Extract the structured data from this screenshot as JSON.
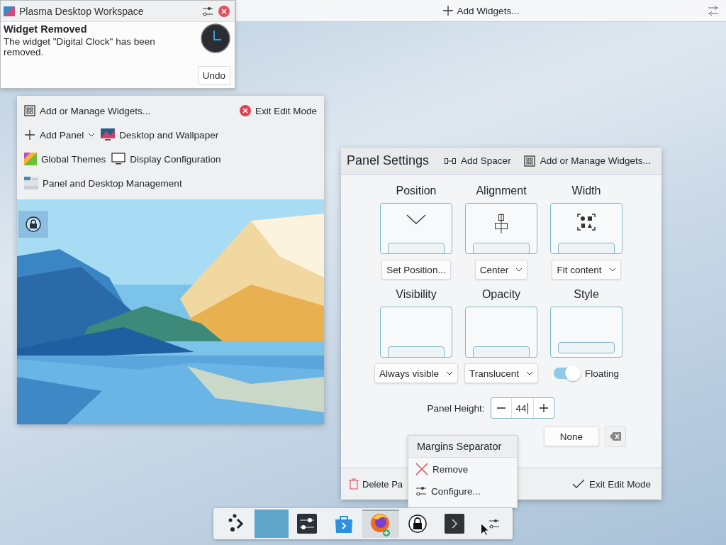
{
  "top_bar": {
    "add_widgets": "Add Widgets..."
  },
  "notification": {
    "app_name": "Plasma Desktop Workspace",
    "title": "Widget Removed",
    "body": "The widget \"Digital Clock\" has been removed.",
    "action": "Undo"
  },
  "edit_toolbar": {
    "rows": [
      [
        {
          "kind": "widgets",
          "label": "Add or Manage Widgets..."
        },
        {
          "kind": "exit",
          "label": "Exit Edit Mode"
        }
      ],
      [
        {
          "kind": "add-panel",
          "label": "Add Panel"
        },
        {
          "kind": "wallpaper",
          "label": "Desktop and Wallpaper"
        }
      ],
      [
        {
          "kind": "themes",
          "label": "Global Themes"
        },
        {
          "kind": "display",
          "label": "Display Configuration"
        }
      ],
      [
        {
          "kind": "management",
          "label": "Panel and Desktop Management"
        }
      ]
    ]
  },
  "panel_settings": {
    "title": "Panel Settings",
    "actions": [
      {
        "kind": "spacer",
        "label": "Add Spacer"
      },
      {
        "kind": "widgets",
        "label": "Add or Manage Widgets..."
      }
    ],
    "options": [
      {
        "kind": "position",
        "label": "Position",
        "control": {
          "kind": "button",
          "label": "Set Position..."
        }
      },
      {
        "kind": "alignment",
        "label": "Alignment",
        "control": {
          "kind": "dropdown",
          "label": "Center"
        }
      },
      {
        "kind": "width",
        "label": "Width",
        "control": {
          "kind": "dropdown",
          "label": "Fit content"
        }
      },
      {
        "kind": "visibility",
        "label": "Visibility",
        "control": {
          "kind": "dropdown",
          "label": "Always visible"
        }
      },
      {
        "kind": "opacity",
        "label": "Opacity",
        "control": {
          "kind": "dropdown",
          "label": "Translucent"
        }
      },
      {
        "kind": "style",
        "label": "Style",
        "control": {
          "kind": "switch",
          "label": "Floating",
          "on": true
        }
      }
    ],
    "height_label": "Panel Height:",
    "height_value": "44",
    "shortcut_value": "None",
    "delete": "Delete Pa",
    "exit": "Exit Edit Mode"
  },
  "context_menu": {
    "title": "Margins Separator",
    "items": [
      {
        "kind": "remove",
        "label": "Remove"
      },
      {
        "kind": "configure",
        "label": "Configure..."
      }
    ]
  },
  "taskbar": {
    "items": [
      {
        "kind": "launcher",
        "selected": false
      },
      {
        "kind": "separator",
        "selected": true
      },
      {
        "kind": "settings",
        "selected": false
      },
      {
        "kind": "store",
        "selected": false
      },
      {
        "kind": "browser",
        "selected": false
      },
      {
        "kind": "lock",
        "selected": false
      },
      {
        "kind": "terminal",
        "selected": false
      },
      {
        "kind": "tray",
        "selected": false
      }
    ]
  }
}
